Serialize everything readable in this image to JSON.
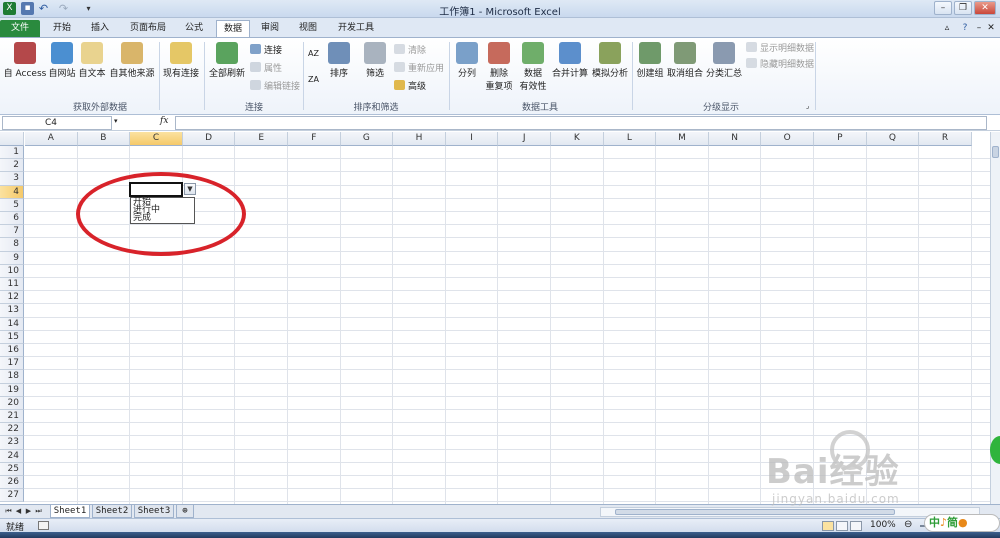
{
  "window": {
    "title": "工作簿1 - Microsoft Excel"
  },
  "quick_access": [
    "excel-logo-icon",
    "save-icon",
    "undo-icon",
    "redo-icon",
    "customize-icon"
  ],
  "tabs": [
    {
      "label": "文件",
      "kind": "file"
    },
    {
      "label": "开始"
    },
    {
      "label": "插入"
    },
    {
      "label": "页面布局"
    },
    {
      "label": "公式"
    },
    {
      "label": "数据",
      "active": true
    },
    {
      "label": "审阅"
    },
    {
      "label": "视图"
    },
    {
      "label": "开发工具"
    }
  ],
  "ribbon": {
    "groups": {
      "external": "获取外部数据",
      "connections": "连接",
      "sort_filter": "排序和筛选",
      "data_tools": "数据工具",
      "outline": "分级显示"
    },
    "buttons": {
      "from_access": "自 Access",
      "from_web": "自网站",
      "from_text": "自文本",
      "from_other": "自其他来源",
      "existing": "现有连接",
      "refresh_all": "全部刷新",
      "connections": "连接",
      "properties": "属性",
      "edit_links": "编辑链接",
      "sort": "排序",
      "filter": "筛选",
      "clear": "清除",
      "reapply": "重新应用",
      "advanced": "高级",
      "text_to_columns": "分列",
      "remove_dup_1": "删除",
      "remove_dup_2": "重复项",
      "validation_1": "数据",
      "validation_2": "有效性",
      "consolidate": "合并计算",
      "whatif": "模拟分析",
      "group": "创建组",
      "ungroup": "取消组合",
      "subtotal": "分类汇总",
      "show_detail": "显示明细数据",
      "hide_detail": "隐藏明细数据"
    },
    "sort_az": "AZ",
    "sort_za": "ZA"
  },
  "formula_bar": {
    "name_box": "C4",
    "fx": "fx",
    "value": ""
  },
  "grid": {
    "columns": [
      "A",
      "B",
      "C",
      "D",
      "E",
      "F",
      "G",
      "H",
      "I",
      "J",
      "K",
      "L",
      "M",
      "N",
      "O",
      "P",
      "Q",
      "R"
    ],
    "row_count": 27,
    "selected_column": "C",
    "selected_row": 4,
    "active_cell": "C4"
  },
  "dropdown": {
    "options": [
      "开始",
      "进行中",
      "完成"
    ]
  },
  "sheets": [
    {
      "label": "Sheet1",
      "active": true
    },
    {
      "label": "Sheet2"
    },
    {
      "label": "Sheet3"
    }
  ],
  "status": {
    "text": "就绪",
    "zoom": "100%"
  },
  "watermark": {
    "brand": "Bai经验",
    "url": "jingyan.baidu.com"
  },
  "badge": {
    "a": "中",
    "b": "♪",
    "c": "简",
    "d": "●"
  },
  "colors": {
    "accent": "#2a8a3e",
    "selection": "#f5c96a",
    "ring": "#d8232a"
  }
}
